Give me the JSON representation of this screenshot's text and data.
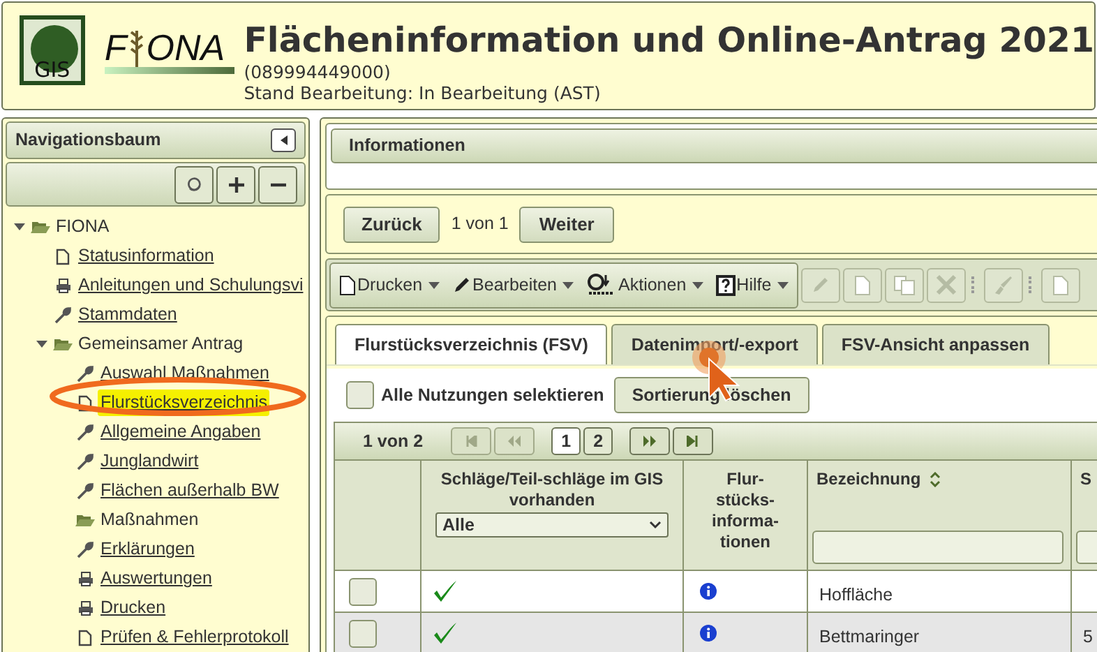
{
  "header": {
    "logo_badge": "GIS",
    "logo_parts": [
      "F",
      "ONA"
    ],
    "title": "Flächeninformation und Online-Antrag 2021",
    "id_line": "(089994449000)",
    "status_line": "Stand Bearbeitung: In Bearbeitung (AST)"
  },
  "sidebar": {
    "title": "Navigationsbaum",
    "tree": [
      {
        "label": "FIONA",
        "kind": "folder",
        "expanded": true,
        "selected": false,
        "children": [
          {
            "label": "Statusinformation",
            "kind": "page",
            "selected": false
          },
          {
            "label": "Anleitungen und Schulungsvi",
            "kind": "printer",
            "selected": false
          },
          {
            "label": "Stammdaten",
            "kind": "tool",
            "selected": false
          },
          {
            "label": "Gemeinsamer Antrag",
            "kind": "folder",
            "expanded": true,
            "selected": false,
            "children": [
              {
                "label": "Auswahl Maßnahmen",
                "kind": "tool",
                "selected": false
              },
              {
                "label": "Flurstücksverzeichnis",
                "kind": "page",
                "selected": true
              },
              {
                "label": "Allgemeine Angaben",
                "kind": "tool",
                "selected": false
              },
              {
                "label": "Junglandwirt",
                "kind": "tool",
                "selected": false
              },
              {
                "label": "Flächen außerhalb BW",
                "kind": "tool",
                "selected": false
              },
              {
                "label": "Maßnahmen",
                "kind": "folder",
                "expanded": false,
                "selected": false
              },
              {
                "label": "Erklärungen",
                "kind": "tool",
                "selected": false
              },
              {
                "label": "Auswertungen",
                "kind": "printer",
                "selected": false
              },
              {
                "label": "Drucken",
                "kind": "printer",
                "selected": false
              },
              {
                "label": "Prüfen & Fehlerprotokoll",
                "kind": "page",
                "selected": false
              }
            ]
          }
        ]
      }
    ]
  },
  "info_panel": {
    "title": "Informationen"
  },
  "record_nav": {
    "back": "Zurück",
    "position": "1 von 1",
    "next": "Weiter"
  },
  "toolbar": {
    "menus": [
      {
        "label": "Drucken",
        "kind": "page"
      },
      {
        "label": "Bearbeiten",
        "kind": "pencil"
      },
      {
        "label": "Aktionen",
        "kind": "actions"
      },
      {
        "label": "Hilfe",
        "kind": "help"
      }
    ],
    "tools": [
      {
        "kind": "pencil",
        "disabled": true
      },
      {
        "kind": "page",
        "disabled": true
      },
      {
        "kind": "copy",
        "disabled": true
      },
      {
        "kind": "delete",
        "disabled": true
      },
      {
        "kind": "sep"
      },
      {
        "kind": "brush",
        "disabled": true
      },
      {
        "kind": "sep"
      },
      {
        "kind": "page",
        "disabled": true
      }
    ]
  },
  "tabs": [
    {
      "label": "Flurstücksverzeichnis (FSV)",
      "selected": true
    },
    {
      "label": "Datenimport/-export",
      "selected": false
    },
    {
      "label": "FSV-Ansicht anpassen",
      "selected": false
    }
  ],
  "filter_bar": {
    "select_all": {
      "label": "Alle Nutzungen selektieren",
      "checked": false
    },
    "clear_sort": "Sortierung löschen"
  },
  "pager": {
    "position": "1 von 2",
    "pages": [
      {
        "label": "1",
        "selected": true
      },
      {
        "label": "2",
        "selected": false
      }
    ]
  },
  "table": {
    "columns": [
      {
        "kind": "check"
      },
      {
        "kind": "gis",
        "label": "Schläge/Teil-schläge im GIS vorhanden",
        "filter_select": "Alle"
      },
      {
        "kind": "info",
        "label": "Flur-stücks-informa-tionen"
      },
      {
        "kind": "text",
        "label": "Bezeichnung",
        "sortable": true
      },
      {
        "kind": "text",
        "label": "S"
      }
    ],
    "rows": [
      {
        "checked": false,
        "in_gis": true,
        "name": "Hoffläche"
      },
      {
        "checked": false,
        "in_gis": true,
        "name": "Bettmaringer",
        "column_5": "5"
      }
    ]
  }
}
